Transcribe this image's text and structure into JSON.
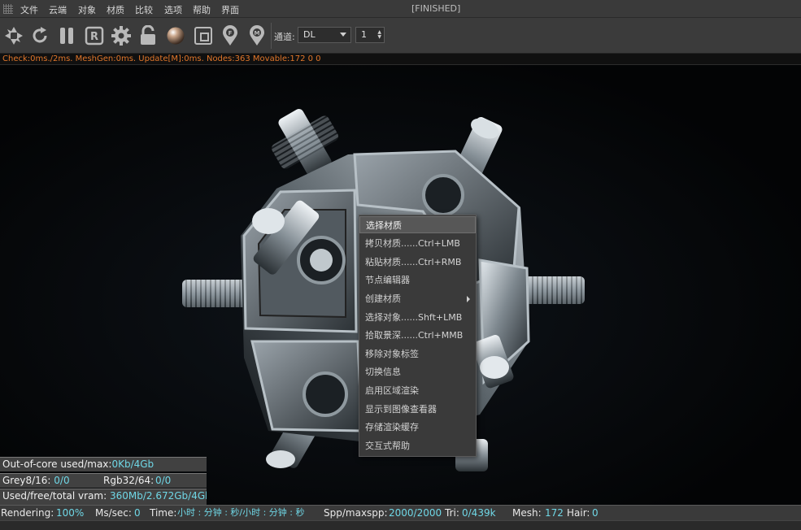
{
  "menubar": {
    "items": [
      "文件",
      "云端",
      "对象",
      "材质",
      "比较",
      "选项",
      "帮助",
      "界面"
    ],
    "status": "[FINISHED]"
  },
  "toolbar": {
    "icons": [
      "camera-aperture-icon",
      "reload-icon",
      "pause-icon",
      "render-r-icon",
      "settings-gear-icon",
      "lock-icon",
      "material-ball-icon",
      "region-render-icon",
      "focus-pick-icon",
      "material-pick-icon"
    ],
    "channel_label": "通道:",
    "channel_value": "DL",
    "spinner_value": "1"
  },
  "infoline": "Check:0ms./2ms. MeshGen:0ms. Update[M]:0ms. Nodes:363 Movable:172  0 0",
  "context_menu": [
    {
      "label": "选择材质",
      "active": true
    },
    {
      "label": "拷贝材质......Ctrl+LMB"
    },
    {
      "label": "粘贴材质......Ctrl+RMB"
    },
    {
      "label": "节点编辑器"
    },
    {
      "label": "创建材质",
      "submenu": true
    },
    {
      "label": "选择对象......Shft+LMB"
    },
    {
      "label": "拾取景深......Ctrl+MMB"
    },
    {
      "label": "移除对象标签"
    },
    {
      "label": "切换信息"
    },
    {
      "label": "启用区域渲染"
    },
    {
      "label": "显示到图像查看器"
    },
    {
      "label": "存储渲染缓存"
    },
    {
      "label": "交互式帮助"
    }
  ],
  "stats": {
    "ooc_label": "Out-of-core used/max:",
    "ooc_value": "0Kb/4Gb",
    "grey_label": "Grey8/16:",
    "grey_value": "0/0",
    "rgb_label": "Rgb32/64:",
    "rgb_value": "0/0",
    "vram_label": "Used/free/total vram:",
    "vram_value": "360Mb/2.672Gb/4Gb"
  },
  "statusbar": {
    "rendering_label": "Rendering:",
    "rendering_value": "100%",
    "mssec_label": "Ms/sec:",
    "mssec_value": "0",
    "time_label": "Time:",
    "time_value": "小时 : 分钟 : 秒/小时 : 分钟 : 秒",
    "spp_label": "Spp/maxspp:",
    "spp_value": "2000/2000",
    "tri_label": "Tri:",
    "tri_value": "0/439k",
    "mesh_label": "Mesh:",
    "mesh_value": "172",
    "hair_label": "Hair:",
    "hair_value": "0"
  },
  "colors": {
    "accent_cyan": "#6fd7e6",
    "info_orange": "#e0762a"
  }
}
